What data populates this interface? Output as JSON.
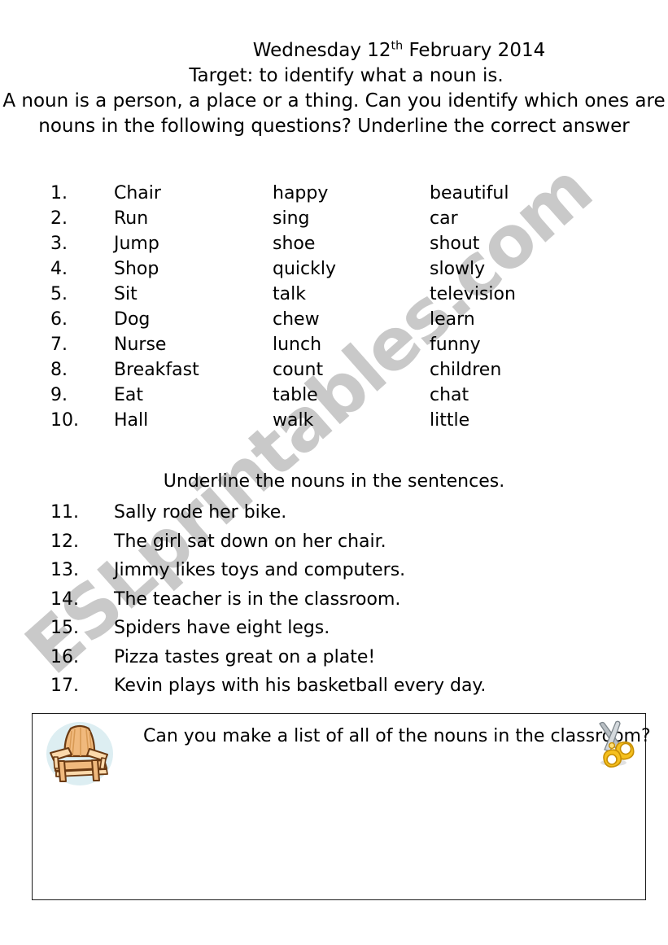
{
  "document": {
    "date": {
      "weekday_and_day": "Wednesday 12",
      "ordinal_suffix": "th",
      "month_and_year": " February 2014"
    },
    "target_line": "Target: to identify what a noun is.",
    "intro_line_1": "A noun is a person, a place or a thing.  Can you identify which ones are",
    "intro_line_2": "nouns in the following questions? Underline the correct answer"
  },
  "word_list": {
    "rows": [
      {
        "num": "1.",
        "col1": "Chair",
        "col2": "happy",
        "col3": "beautiful"
      },
      {
        "num": "2.",
        "col1": "Run",
        "col2": "sing",
        "col3": "car"
      },
      {
        "num": "3.",
        "col1": "Jump",
        "col2": "shoe",
        "col3": "shout"
      },
      {
        "num": "4.",
        "col1": "Shop",
        "col2": "quickly",
        "col3": "slowly"
      },
      {
        "num": "5.",
        "col1": "Sit",
        "col2": "talk",
        "col3": "television"
      },
      {
        "num": "6.",
        "col1": "Dog",
        "col2": "chew",
        "col3": "learn"
      },
      {
        "num": "7.",
        "col1": "Nurse",
        "col2": "lunch",
        "col3": "funny"
      },
      {
        "num": "8.",
        "col1": "Breakfast",
        "col2": "count",
        "col3": "children"
      },
      {
        "num": "9.",
        "col1": "Eat",
        "col2": "table",
        "col3": "chat"
      },
      {
        "num": "10.",
        "col1": "Hall",
        "col2": "walk",
        "col3": "little"
      }
    ]
  },
  "sentences": {
    "heading": "Underline the nouns in the sentences.",
    "rows": [
      {
        "num": "11.",
        "text": "Sally rode her bike."
      },
      {
        "num": "12.",
        "text": "The girl sat down on her chair."
      },
      {
        "num": "13.",
        "text": "Jimmy likes toys and computers."
      },
      {
        "num": "14.",
        "text": "The teacher is in the classroom."
      },
      {
        "num": "15.",
        "text": "Spiders have eight legs."
      },
      {
        "num": "16.",
        "text": "Pizza tastes great on a plate!"
      },
      {
        "num": "17.",
        "text": "Kevin plays with his basketball every day."
      }
    ]
  },
  "task_box": {
    "question": "Can you make a list of all of the nouns in the classroom?",
    "left_icon": "chair-icon",
    "right_icon": "scissors-icon"
  },
  "watermark": {
    "text": "ESLprintables.com"
  },
  "colors": {
    "text": "#000000",
    "watermark": "#c9c9c9",
    "box_border": "#1a1a1a",
    "chair_wood": "#f0b97d",
    "chair_wood_light": "#fbd9ab",
    "chair_outline": "#6b3a12",
    "chair_bg_oval": "#ddeef2",
    "scissors_gold": "#f5c01e",
    "scissors_gold_light": "#ffe07a",
    "scissors_blade": "#b9bfc4"
  }
}
